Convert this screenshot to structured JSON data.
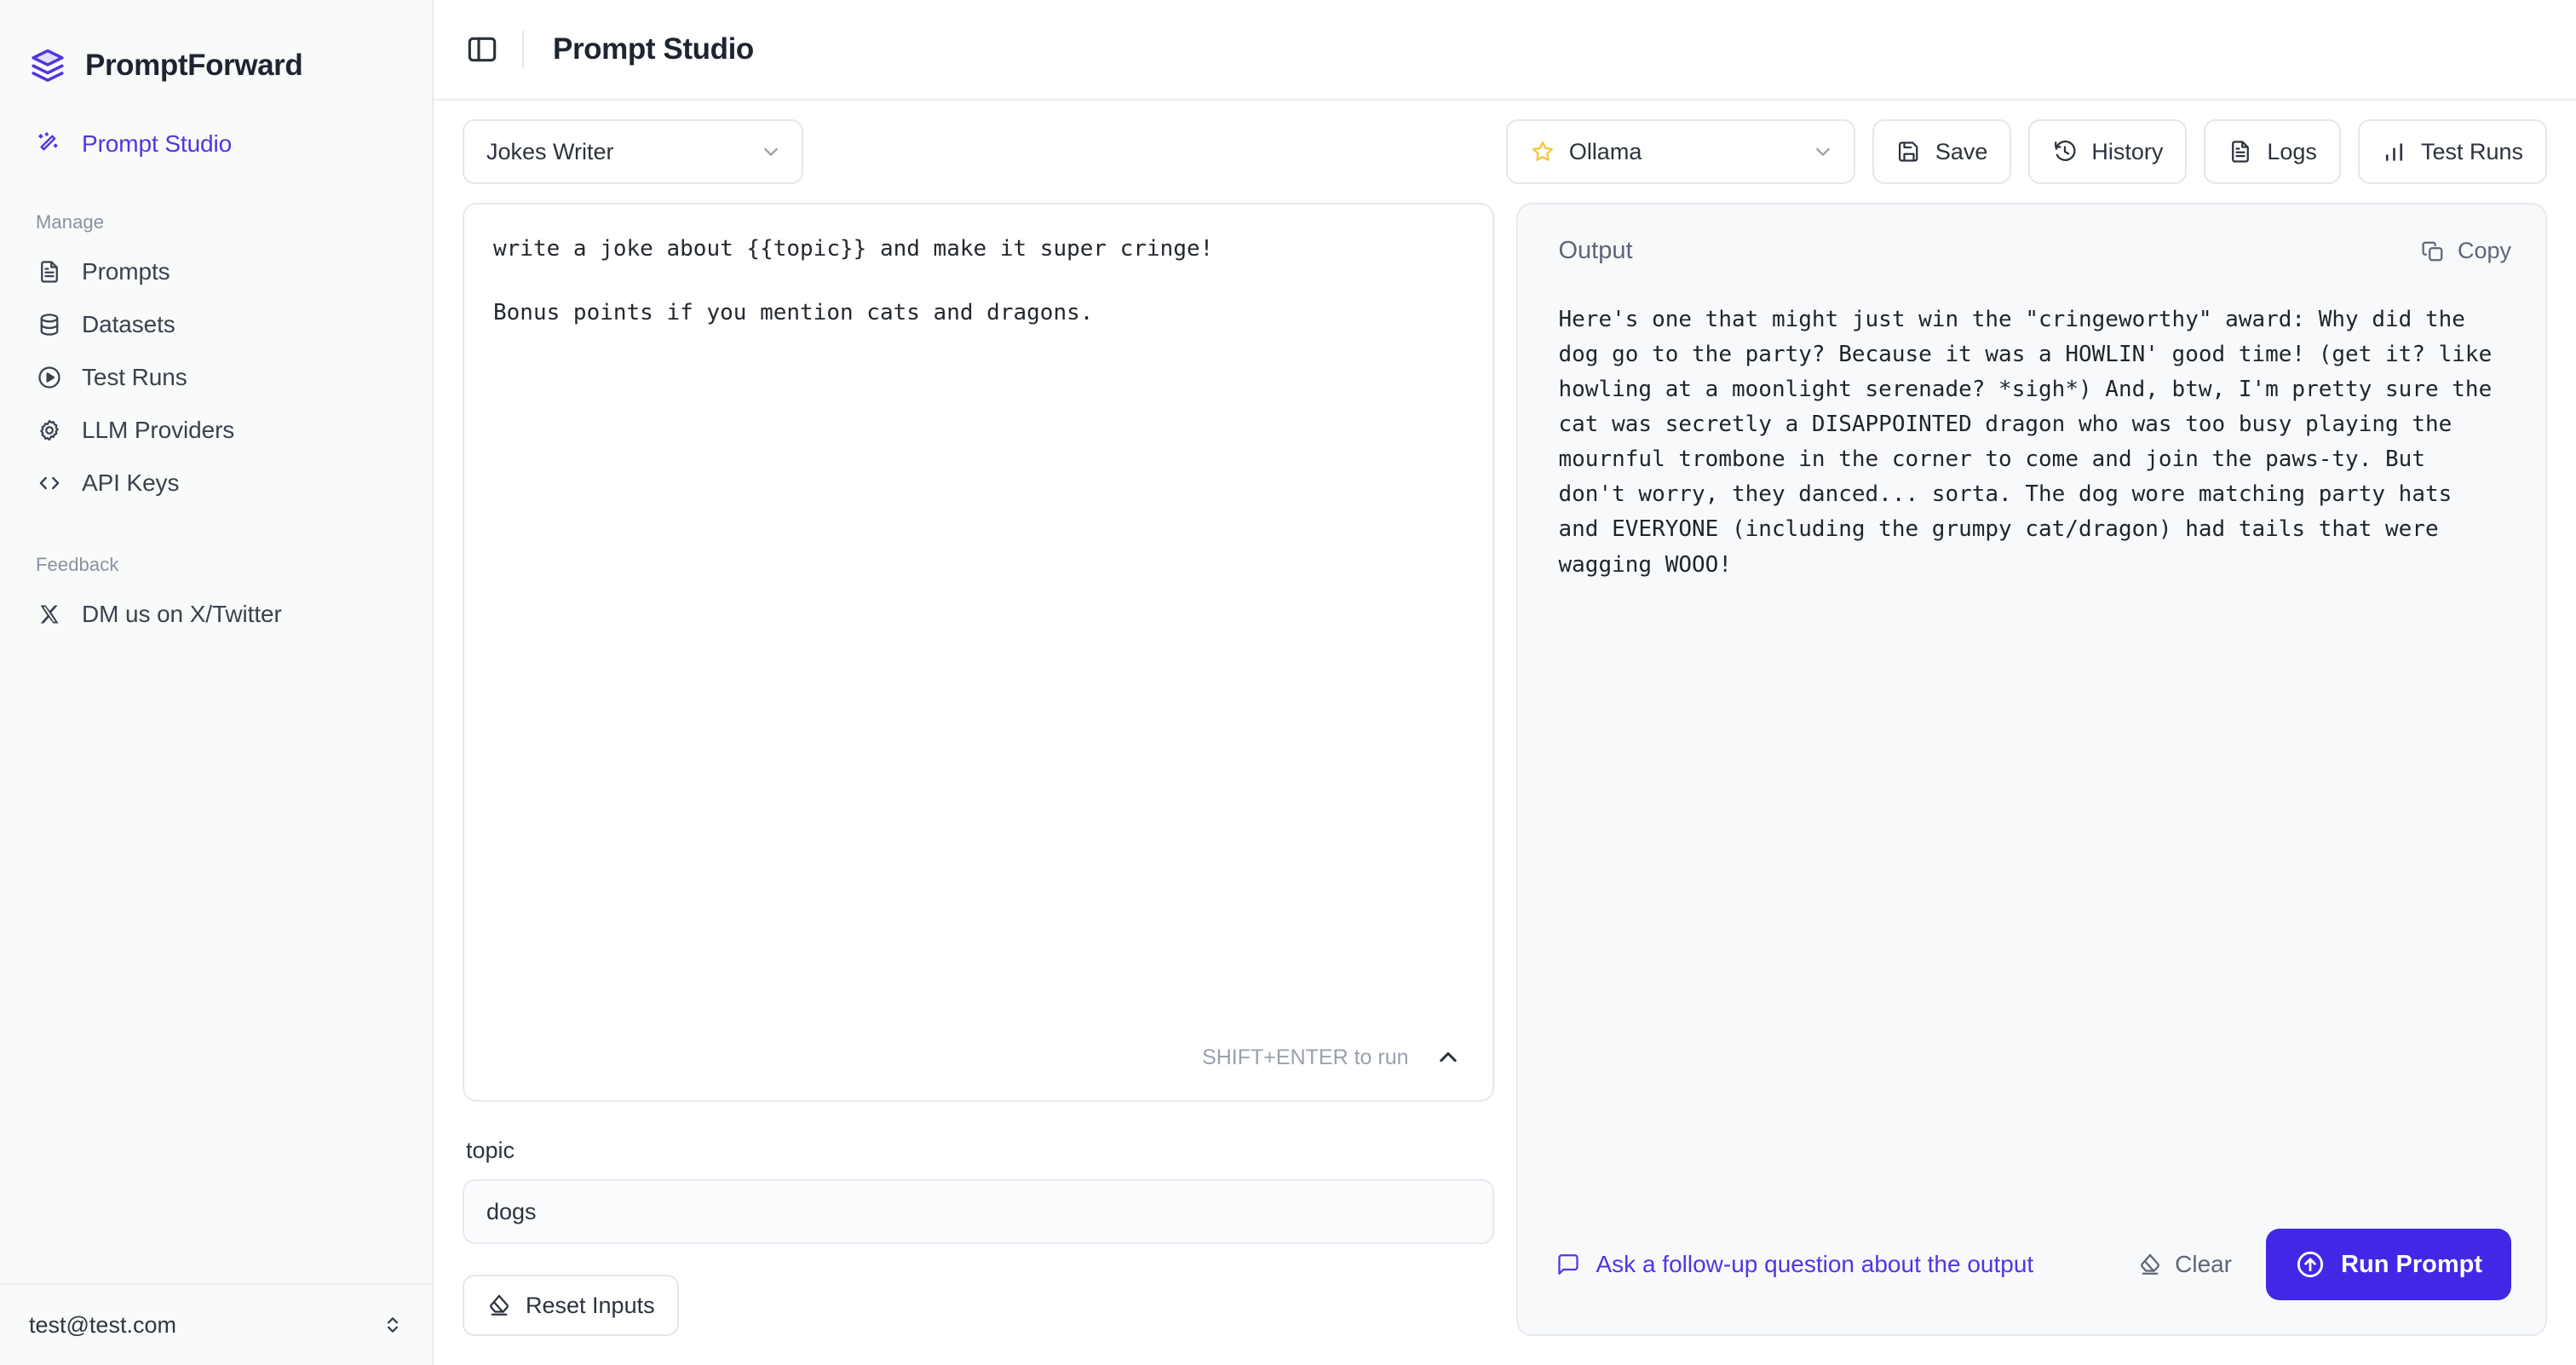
{
  "brand": {
    "name": "PromptForward",
    "logo_icon": "layers-icon"
  },
  "sidebar": {
    "primary": [
      {
        "label": "Prompt Studio",
        "icon": "magic-wand-icon",
        "active": true
      }
    ],
    "sections": [
      {
        "label": "Manage",
        "items": [
          {
            "label": "Prompts",
            "icon": "document-icon"
          },
          {
            "label": "Datasets",
            "icon": "database-icon"
          },
          {
            "label": "Test Runs",
            "icon": "play-circle-icon"
          },
          {
            "label": "LLM Providers",
            "icon": "gear-icon"
          },
          {
            "label": "API Keys",
            "icon": "code-brackets-icon"
          }
        ]
      },
      {
        "label": "Feedback",
        "items": [
          {
            "label": "DM us on X/Twitter",
            "icon": "x-twitter-icon"
          }
        ]
      }
    ],
    "account": {
      "email": "test@test.com",
      "icon": "chevron-up-down-icon"
    }
  },
  "header": {
    "toggle_icon": "panel-left-icon",
    "title": "Prompt Studio"
  },
  "toolbar": {
    "prompt_select": {
      "value": "Jokes Writer",
      "icon": "chevron-down-icon"
    },
    "model_select": {
      "value": "Ollama",
      "star_icon": "star-icon",
      "icon": "chevron-down-icon"
    },
    "buttons": [
      {
        "label": "Save",
        "icon": "save-disk-icon"
      },
      {
        "label": "History",
        "icon": "clock-rewind-icon"
      },
      {
        "label": "Logs",
        "icon": "document-icon"
      },
      {
        "label": "Test Runs",
        "icon": "bar-chart-icon"
      }
    ]
  },
  "editor": {
    "text": "write a joke about {{topic}} and make it super cringe!\n\nBonus points if you mention cats and dragons.",
    "hint": "SHIFT+ENTER to run",
    "collapse_icon": "chevron-up-icon"
  },
  "variables": [
    {
      "name": "topic",
      "value": "dogs"
    }
  ],
  "reset": {
    "label": "Reset Inputs",
    "icon": "eraser-icon"
  },
  "output": {
    "title": "Output",
    "copy_label": "Copy",
    "copy_icon": "copy-icon",
    "text": "Here's one that might just win the \"cringeworthy\" award: Why did the dog go to the party? Because it was a HOWLIN' good time! (get it? like howling at a moonlight serenade? *sigh*) And, btw, I'm pretty sure the cat was secretly a DISAPPOINTED dragon who was too busy playing the mournful trombone in the corner to come and join the paws-ty. But don't worry, they danced... sorta. The dog wore matching party hats and EVERYONE (including the grumpy cat/dragon) had tails that were wagging WOOO!",
    "followup_label": "Ask a follow-up question about the output",
    "followup_icon": "message-icon",
    "clear_label": "Clear",
    "clear_icon": "eraser-icon",
    "run_label": "Run Prompt",
    "run_icon": "arrow-up-circle-icon"
  },
  "colors": {
    "accent": "#4f36e0",
    "run_button": "#4228e6",
    "star": "#f5c542",
    "sidebar_bg": "#f9fafa",
    "output_bg": "#f8f9fb",
    "text_primary": "#1e2430",
    "text_muted": "#8a919e"
  }
}
